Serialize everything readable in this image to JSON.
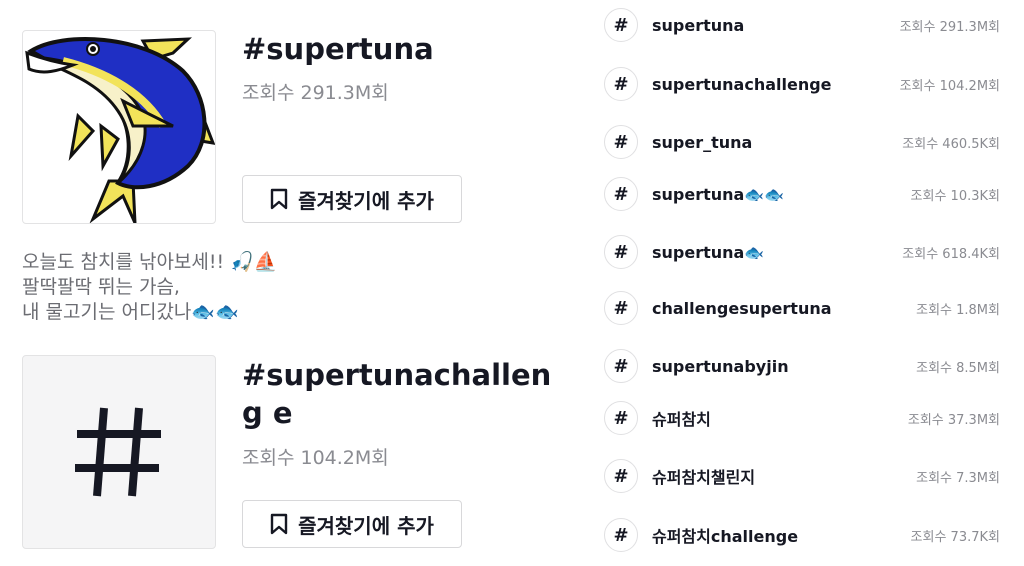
{
  "featured": [
    {
      "title": "#supertuna",
      "views": "조회수 291.3M회",
      "favorite_label": "즐겨찾기에 추가",
      "description": "오늘도 참치를 낚아보세!! 🎣⛵\n팔딱팔딱 뛰는 가슴,\n내 물고기는 어디갔나🐟🐟",
      "image": "tuna-illustration"
    },
    {
      "title": "#supertunachalleng e",
      "views": "조회수 104.2M회",
      "favorite_label": "즐겨찾기에 추가",
      "image": "hashtag-icon"
    }
  ],
  "hashtag_list": [
    {
      "name": "supertuna",
      "views": "조회수 291.3M회"
    },
    {
      "name": "supertunachallenge",
      "views": "조회수 104.2M회"
    },
    {
      "name": "super_tuna",
      "views": "조회수 460.5K회"
    },
    {
      "name": "supertuna🐟🐟",
      "views": "조회수 10.3K회"
    },
    {
      "name": "supertuna🐟",
      "views": "조회수 618.4K회"
    },
    {
      "name": "challengesupertuna",
      "views": "조회수 1.8M회"
    },
    {
      "name": "supertunabyjin",
      "views": "조회수 8.5M회"
    },
    {
      "name": "슈퍼참치",
      "views": "조회수 37.3M회"
    },
    {
      "name": "슈퍼참치챌린지",
      "views": "조회수 7.3M회"
    },
    {
      "name": "슈퍼참치challenge",
      "views": "조회수 73.7K회"
    }
  ],
  "icons": {
    "hash": "#",
    "bookmark": "bookmark-icon"
  },
  "colors": {
    "text": "#161823",
    "muted": "#8a8b91",
    "tuna_blue": "#1f2fc4",
    "tuna_yellow": "#f2e35a"
  }
}
